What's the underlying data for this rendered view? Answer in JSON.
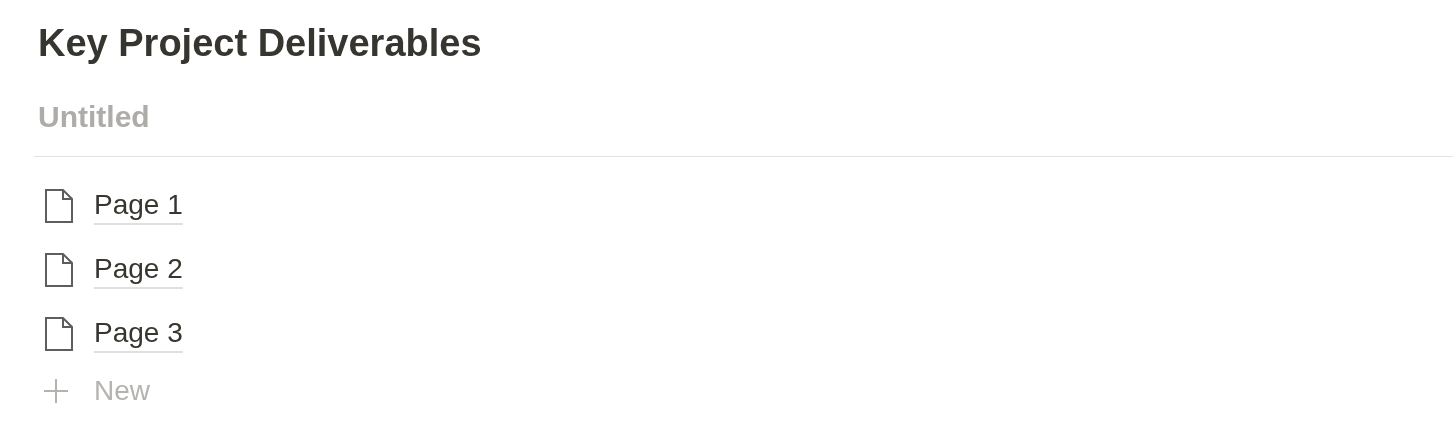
{
  "title": "Key Project Deliverables",
  "group": {
    "name": "Untitled"
  },
  "pages": [
    {
      "title": "Page 1"
    },
    {
      "title": "Page 2"
    },
    {
      "title": "Page 3"
    }
  ],
  "new_button": {
    "label": "New"
  }
}
